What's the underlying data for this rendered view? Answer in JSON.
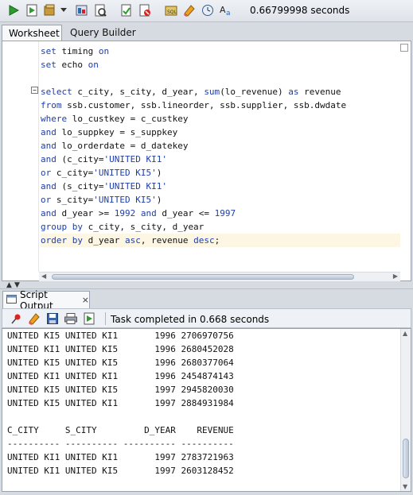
{
  "toolbar": {
    "buttons": [
      "run-statement-icon",
      "run-script-icon",
      "commit-icon",
      "autotrace-icon",
      "explain-plan-icon",
      "sql-tuning-icon",
      "rollback-icon",
      "format-icon",
      "clear-icon",
      "history-icon",
      "font-case-icon"
    ],
    "elapsed": "0.66799998 seconds"
  },
  "tabs": {
    "worksheet": "Worksheet",
    "query_builder": "Query Builder"
  },
  "editor": {
    "lines": [
      [
        {
          "t": "set ",
          "c": "kw"
        },
        {
          "t": "timing ",
          "c": ""
        },
        {
          "t": "on",
          "c": "kw"
        }
      ],
      [
        {
          "t": "set ",
          "c": "kw"
        },
        {
          "t": "echo ",
          "c": ""
        },
        {
          "t": "on",
          "c": "kw"
        }
      ],
      [
        {
          "t": "",
          "c": ""
        }
      ],
      [
        {
          "t": "select ",
          "c": "kw"
        },
        {
          "t": "c_city, s_city, d_year, ",
          "c": ""
        },
        {
          "t": "sum",
          "c": "kw"
        },
        {
          "t": "(lo_revenue) ",
          "c": ""
        },
        {
          "t": "as ",
          "c": "kw"
        },
        {
          "t": "revenue",
          "c": ""
        }
      ],
      [
        {
          "t": "from ",
          "c": "kw"
        },
        {
          "t": "ssb.customer, ssb.lineorder, ssb.supplier, ssb.dwdate",
          "c": ""
        }
      ],
      [
        {
          "t": "where ",
          "c": "kw"
        },
        {
          "t": "lo_custkey = c_custkey",
          "c": ""
        }
      ],
      [
        {
          "t": "and ",
          "c": "kw"
        },
        {
          "t": "lo_suppkey = s_suppkey",
          "c": ""
        }
      ],
      [
        {
          "t": "and ",
          "c": "kw"
        },
        {
          "t": "lo_orderdate = d_datekey",
          "c": ""
        }
      ],
      [
        {
          "t": "and ",
          "c": "kw"
        },
        {
          "t": "(c_city=",
          "c": ""
        },
        {
          "t": "'UNITED KI1'",
          "c": "str"
        }
      ],
      [
        {
          "t": "or ",
          "c": "kw"
        },
        {
          "t": "c_city=",
          "c": ""
        },
        {
          "t": "'UNITED KI5'",
          "c": "str"
        },
        {
          "t": ")",
          "c": ""
        }
      ],
      [
        {
          "t": "and ",
          "c": "kw"
        },
        {
          "t": "(s_city=",
          "c": ""
        },
        {
          "t": "'UNITED KI1'",
          "c": "str"
        }
      ],
      [
        {
          "t": "or ",
          "c": "kw"
        },
        {
          "t": "s_city=",
          "c": ""
        },
        {
          "t": "'UNITED KI5'",
          "c": "str"
        },
        {
          "t": ")",
          "c": ""
        }
      ],
      [
        {
          "t": "and ",
          "c": "kw"
        },
        {
          "t": "d_year >= ",
          "c": ""
        },
        {
          "t": "1992 ",
          "c": "num"
        },
        {
          "t": "and ",
          "c": "kw"
        },
        {
          "t": "d_year <= ",
          "c": ""
        },
        {
          "t": "1997",
          "c": "num"
        }
      ],
      [
        {
          "t": "group by ",
          "c": "kw"
        },
        {
          "t": "c_city, s_city, d_year",
          "c": ""
        }
      ],
      [
        {
          "t": "order by ",
          "c": "kw"
        },
        {
          "t": "d_year ",
          "c": ""
        },
        {
          "t": "asc",
          "c": "kw"
        },
        {
          "t": ", revenue ",
          "c": ""
        },
        {
          "t": "desc",
          "c": "kw"
        },
        {
          "t": ";",
          "c": ""
        }
      ]
    ],
    "current_line": 14,
    "fold_marker": "−"
  },
  "output_tab": {
    "label": "Script Output",
    "close": "×"
  },
  "output_toolbar": {
    "buttons": [
      "pin-icon",
      "clear-output-icon",
      "save-icon",
      "print-icon",
      "run-script-output-icon"
    ],
    "status": "Task completed in 0.668 seconds"
  },
  "output": {
    "lines": [
      "UNITED KI5 UNITED KI1       1996 2706970756",
      "UNITED KI1 UNITED KI5       1996 2680452028",
      "UNITED KI5 UNITED KI5       1996 2680377064",
      "UNITED KI1 UNITED KI1       1996 2454874143",
      "UNITED KI5 UNITED KI5       1997 2945820030",
      "UNITED KI5 UNITED KI1       1997 2884931984",
      "",
      "C_CITY     S_CITY         D_YEAR    REVENUE",
      "---------- ---------- ---------- ----------",
      "UNITED KI1 UNITED KI1       1997 2783721963",
      "UNITED KI1 UNITED KI5       1997 2603128452"
    ]
  }
}
